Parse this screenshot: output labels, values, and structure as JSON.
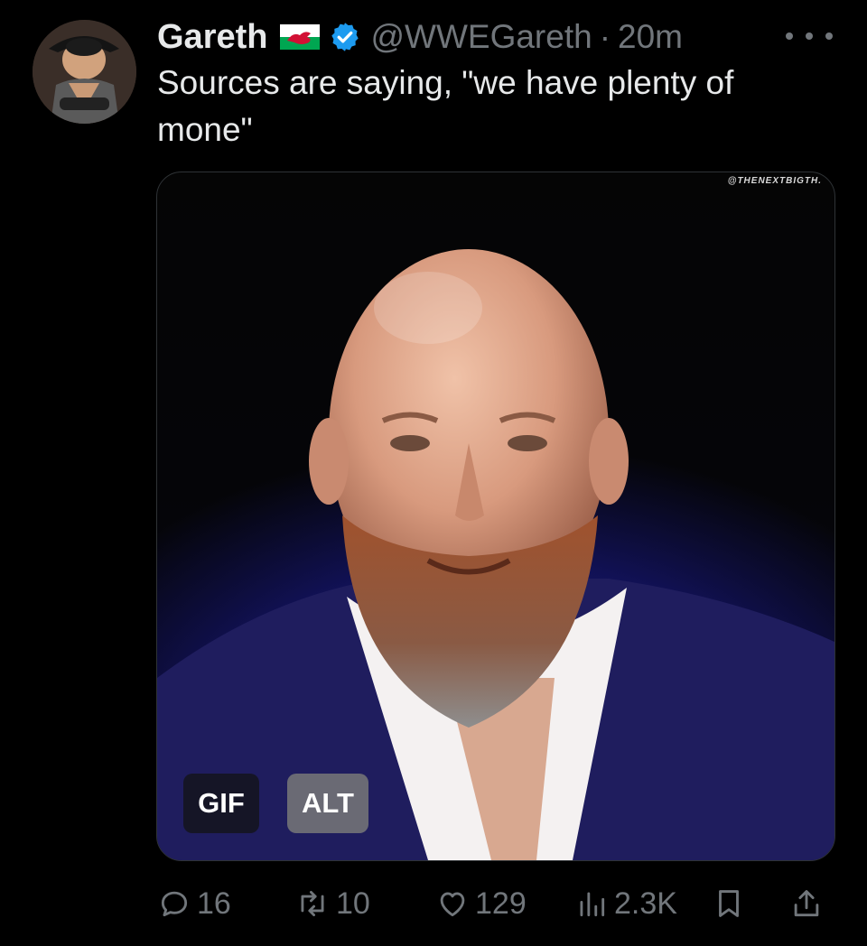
{
  "tweet": {
    "author_name": "Gareth",
    "flag_icon": "wales-flag-icon",
    "verified_icon": "verified-badge-icon",
    "handle": "@WWEGareth",
    "separator": "·",
    "time": "20m",
    "text": "Sources are saying, \"we have plenty of mone\""
  },
  "media": {
    "watermark": "@THENEXTBIGTH.",
    "gif_label": "GIF",
    "alt_label": "ALT"
  },
  "actions": {
    "replies": "16",
    "reposts": "10",
    "likes": "129",
    "views": "2.3K"
  },
  "colors": {
    "background": "#000000",
    "text": "#e7e9ea",
    "muted": "#71767b",
    "verified": "#1d9bf0"
  }
}
